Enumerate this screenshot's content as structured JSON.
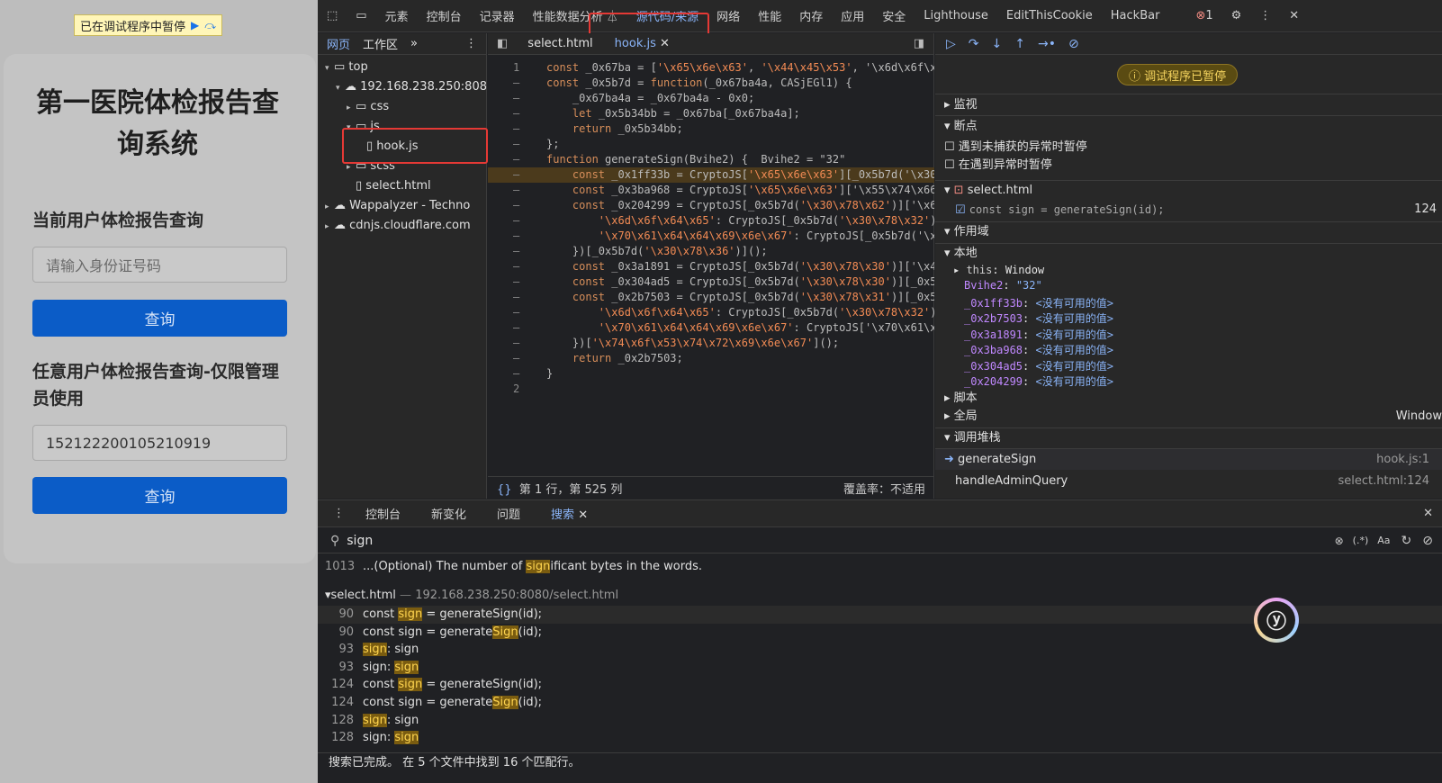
{
  "page": {
    "paused_banner": "已在调试程序中暂停",
    "title": "第一医院体检报告查询系统",
    "section1_label": "当前用户体检报告查询",
    "id_placeholder": "请输入身份证号码",
    "query_button": "查询",
    "section2_label": "任意用户体检报告查询-仅限管理员使用",
    "id_value": "152122200105210919",
    "query_button2": "查询"
  },
  "devtools": {
    "toolbar_tabs": [
      "元素",
      "控制台",
      "记录器",
      "性能数据分析 ⏃",
      "源代码/来源",
      "网络",
      "性能",
      "内存",
      "应用",
      "安全",
      "Lighthouse",
      "EditThisCookie",
      "HackBar"
    ],
    "selected_tab": "源代码/来源",
    "error_count": "1",
    "navigator": {
      "tabs": [
        "网页",
        "工作区"
      ],
      "tree": [
        {
          "label": "top",
          "level": 0,
          "icon": "frame"
        },
        {
          "label": "192.168.238.250:808",
          "level": 1,
          "icon": "cloud"
        },
        {
          "label": "css",
          "level": 2,
          "icon": "folder"
        },
        {
          "label": "js",
          "level": 2,
          "icon": "folder"
        },
        {
          "label": "hook.js",
          "level": 3,
          "icon": "file"
        },
        {
          "label": "scss",
          "level": 2,
          "icon": "folder"
        },
        {
          "label": "select.html",
          "level": 2,
          "icon": "file"
        },
        {
          "label": "Wappalyzer - Techno",
          "level": 0,
          "icon": "cloud"
        },
        {
          "label": "cdnjs.cloudflare.com",
          "level": 0,
          "icon": "cloud"
        }
      ]
    },
    "editor": {
      "tabs": [
        "select.html",
        "hook.js"
      ],
      "active_tab": "hook.js",
      "lines": [
        {
          "n": "1",
          "code": "const _0x67ba = ['\\x65\\x6e\\x63', '\\x44\\x45\\x53', '\\x6d\\x6f\\x"
        },
        {
          "n": "–",
          "code": "const _0x5b7d = function(_0x67ba4a, CASjEGl1) {"
        },
        {
          "n": "–",
          "code": "    _0x67ba4a = _0x67ba4a - 0x0;"
        },
        {
          "n": "–",
          "code": "    let _0x5b34bb = _0x67ba[_0x67ba4a];"
        },
        {
          "n": "–",
          "code": "    return _0x5b34bb;"
        },
        {
          "n": "–",
          "code": "};"
        },
        {
          "n": "–",
          "code": "function generateSign(Bvihe2) {  Bvihe2 = \"32\""
        },
        {
          "n": "–",
          "code": "    const _0x1ff33b = CryptoJS['\\x65\\x6e\\x63'][_0x5b7d('\\x30"
        },
        {
          "n": "–",
          "code": "    const _0x3ba968 = CryptoJS['\\x65\\x6e\\x63']['\\x55\\x74\\x66"
        },
        {
          "n": "–",
          "code": "    const _0x204299 = CryptoJS[_0x5b7d('\\x30\\x78\\x62')]['\\x6"
        },
        {
          "n": "–",
          "code": "        '\\x6d\\x6f\\x64\\x65': CryptoJS[_0x5b7d('\\x30\\x78\\x32')"
        },
        {
          "n": "–",
          "code": "        '\\x70\\x61\\x64\\x64\\x69\\x6e\\x67': CryptoJS[_0x5b7d('\\x"
        },
        {
          "n": "–",
          "code": "    })[_0x5b7d('\\x30\\x78\\x36')]();"
        },
        {
          "n": "–",
          "code": "    const _0x3a1891 = CryptoJS[_0x5b7d('\\x30\\x78\\x30')]['\\x4"
        },
        {
          "n": "–",
          "code": "    const _0x304ad5 = CryptoJS[_0x5b7d('\\x30\\x78\\x30')][_0x5"
        },
        {
          "n": "–",
          "code": "    const _0x2b7503 = CryptoJS[_0x5b7d('\\x30\\x78\\x31')][_0x5"
        },
        {
          "n": "–",
          "code": "        '\\x6d\\x6f\\x64\\x65': CryptoJS[_0x5b7d('\\x30\\x78\\x32')"
        },
        {
          "n": "–",
          "code": "        '\\x70\\x61\\x64\\x64\\x69\\x6e\\x67': CryptoJS['\\x70\\x61\\x"
        },
        {
          "n": "–",
          "code": "    })['\\x74\\x6f\\x53\\x74\\x72\\x69\\x6e\\x67']();"
        },
        {
          "n": "–",
          "code": "    return _0x2b7503;"
        },
        {
          "n": "–",
          "code": "}"
        },
        {
          "n": "2",
          "code": ""
        }
      ],
      "status_position": "第 1 行，第 525 列",
      "status_coverage": "覆盖率：不适用"
    },
    "debugger": {
      "paused_label": "调试程序已暂停",
      "watch": "监视",
      "breakpoints": "断点",
      "pause_uncaught": "遇到未捕获的异常时暂停",
      "pause_caught": "在遇到异常时暂停",
      "bp_file": "select.html",
      "bp_code": "const sign = generateSign(id);",
      "bp_line": "124",
      "scope": "作用域",
      "local": "本地",
      "this_key": "this",
      "this_val": "Window",
      "scope_vars": [
        {
          "k": "Bvihe2",
          "v": "\"32\""
        },
        {
          "k": "_0x1ff33b",
          "v": "<没有可用的值>"
        },
        {
          "k": "_0x2b7503",
          "v": "<没有可用的值>"
        },
        {
          "k": "_0x3a1891",
          "v": "<没有可用的值>"
        },
        {
          "k": "_0x3ba968",
          "v": "<没有可用的值>"
        },
        {
          "k": "_0x304ad5",
          "v": "<没有可用的值>"
        },
        {
          "k": "_0x204299",
          "v": "<没有可用的值>"
        }
      ],
      "script": "脚本",
      "global": "全局",
      "global_val": "Window",
      "callstack": "调用堆栈",
      "frames": [
        {
          "name": "generateSign",
          "loc": "hook.js:1"
        },
        {
          "name": "handleAdminQuery",
          "loc": "select.html:124"
        }
      ]
    },
    "drawer": {
      "tabs": [
        "控制台",
        "新变化",
        "问题",
        "搜索"
      ],
      "active_tab": "搜索",
      "query": "sign",
      "results_top": {
        "n": "1013",
        "pre": "...(Optional) The number of ",
        "match": "sign",
        "post": "ificant bytes in the words."
      },
      "file_header": "select.html",
      "file_url": "192.168.238.250:8080/select.html",
      "rows": [
        {
          "n": "90",
          "pre": "const ",
          "match": "sign",
          "post": " = generateSign(id);"
        },
        {
          "n": "90",
          "pre": "const sign = generate",
          "match": "Sign",
          "post": "(id);"
        },
        {
          "n": "93",
          "pre": "",
          "match": "sign",
          "post": ": sign"
        },
        {
          "n": "93",
          "pre": "sign: ",
          "match": "sign",
          "post": ""
        },
        {
          "n": "124",
          "pre": "const ",
          "match": "sign",
          "post": " = generateSign(id);"
        },
        {
          "n": "124",
          "pre": "const sign = generate",
          "match": "Sign",
          "post": "(id);"
        },
        {
          "n": "128",
          "pre": "",
          "match": "sign",
          "post": ": sign"
        },
        {
          "n": "128",
          "pre": "sign: ",
          "match": "sign",
          "post": ""
        }
      ],
      "status": "搜索已完成。 在 5 个文件中找到 16 个匹配行。"
    }
  },
  "colors": {
    "accent": "#8ab4f8",
    "button": "#0b5cc7",
    "match": "#7a5c10",
    "highlight_box": "#e53935"
  }
}
